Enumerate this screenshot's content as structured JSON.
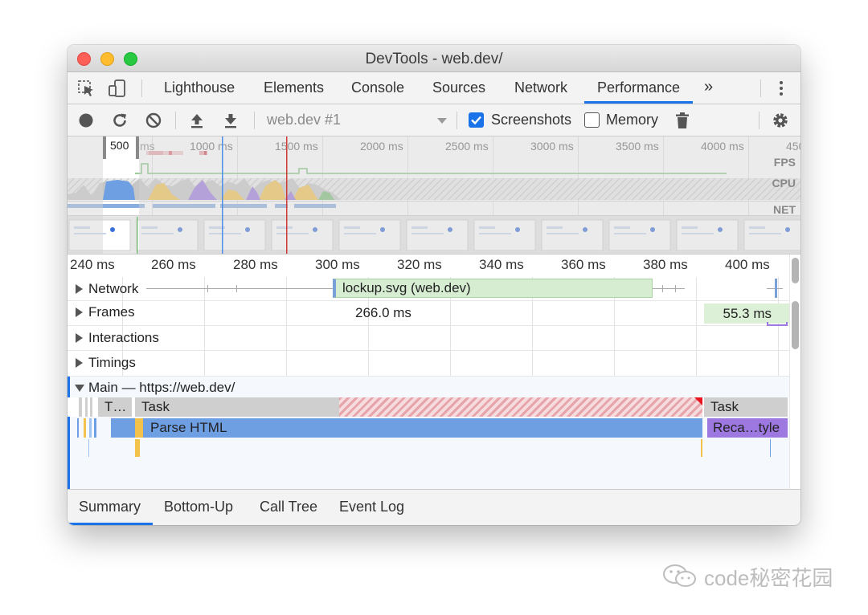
{
  "window": {
    "title": "DevTools - web.dev/"
  },
  "tabs": [
    {
      "label": "Lighthouse"
    },
    {
      "label": "Elements"
    },
    {
      "label": "Console"
    },
    {
      "label": "Sources"
    },
    {
      "label": "Network"
    },
    {
      "label": "Performance",
      "active": true
    }
  ],
  "more_tabs": "»",
  "toolbar": {
    "profile_select": "web.dev #1",
    "screenshots_label": "Screenshots",
    "screenshots_checked": true,
    "memory_label": "Memory",
    "memory_checked": false
  },
  "overview": {
    "ticks": [
      "500",
      "ms",
      "1000 ms",
      "1500 ms",
      "2000 ms",
      "2500 ms",
      "3000 ms",
      "3500 ms",
      "4000 ms",
      "450"
    ],
    "tracks": [
      "FPS",
      "CPU",
      "NET"
    ]
  },
  "flame": {
    "ticks": [
      "240 ms",
      "260 ms",
      "280 ms",
      "300 ms",
      "320 ms",
      "340 ms",
      "360 ms",
      "380 ms",
      "400 ms"
    ],
    "tracks": {
      "network": "Network",
      "frames": "Frames",
      "interactions": "Interactions",
      "timings": "Timings",
      "main": "Main — https://web.dev/"
    },
    "network_request": "lockup.svg (web.dev)",
    "frame_1": "266.0 ms",
    "frame_2": "55.3 ms",
    "tasks": [
      "T…",
      "Task",
      "Task"
    ],
    "events": [
      "Parse HTML",
      "Reca…tyle"
    ]
  },
  "bottom_tabs": [
    {
      "label": "Summary",
      "active": true
    },
    {
      "label": "Bottom-Up"
    },
    {
      "label": "Call Tree"
    },
    {
      "label": "Event Log"
    }
  ],
  "watermark": "code秘密花园",
  "colors": {
    "accent": "#1a73e8",
    "task": "#cfcfcf",
    "long_task": "#e8a2a8",
    "parse_html": "#6e9fe3",
    "recalc_style": "#9d78e0",
    "frame": "#dcf0d7",
    "network": "#d6edd2"
  }
}
